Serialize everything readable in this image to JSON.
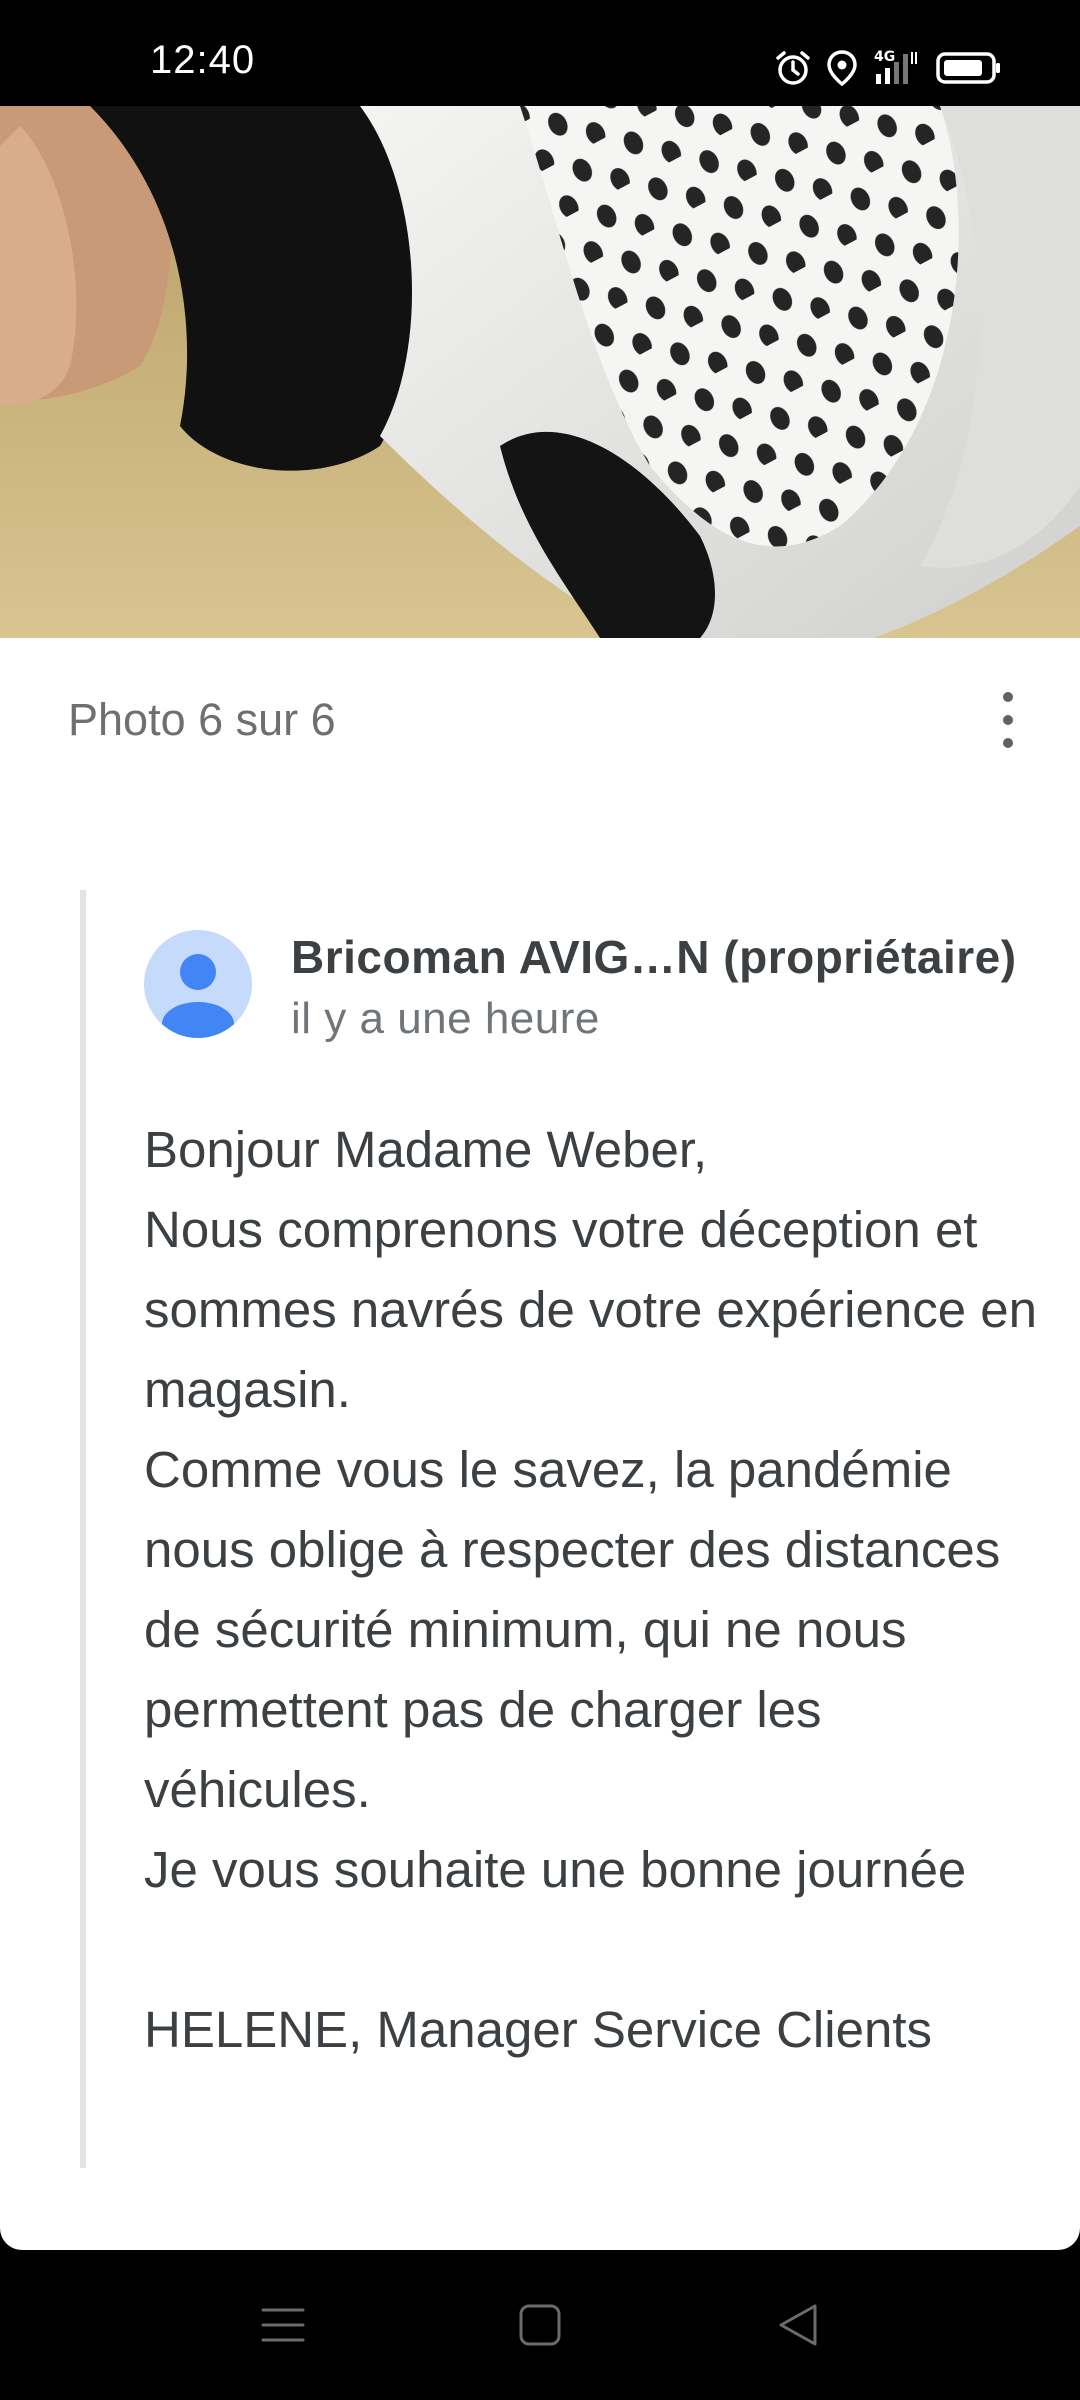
{
  "status_bar": {
    "time": "12:40",
    "network": "4G",
    "icons": [
      "alarm-icon",
      "location-icon",
      "signal-4g-icon",
      "battery-icon"
    ]
  },
  "photo_viewer": {
    "counter": "Photo 6 sur 6",
    "menu_icon": "more-vert-icon"
  },
  "owner_reply": {
    "author": "Bricoman AVIG…N (propriétaire)",
    "time": "il y a une heure",
    "avatar_icon": "person-avatar-icon",
    "text": "Bonjour Madame Weber,\nNous comprenons votre déception et sommes navrés de votre expérience en magasin.\nComme vous le savez, la pandémie nous oblige à respecter des distances de sécurité minimum, qui ne nous permettent pas de charger les véhicules.\nJe vous souhaite une bonne journée\n\nHELENE, Manager Service Clients"
  },
  "nav_bar": {
    "buttons": [
      "menu-icon",
      "home-icon",
      "back-icon"
    ]
  },
  "colors": {
    "avatar_bg": "#c6dafc",
    "avatar_fg": "#4285f4",
    "text_primary": "#3c4043",
    "text_secondary": "#70757a"
  }
}
